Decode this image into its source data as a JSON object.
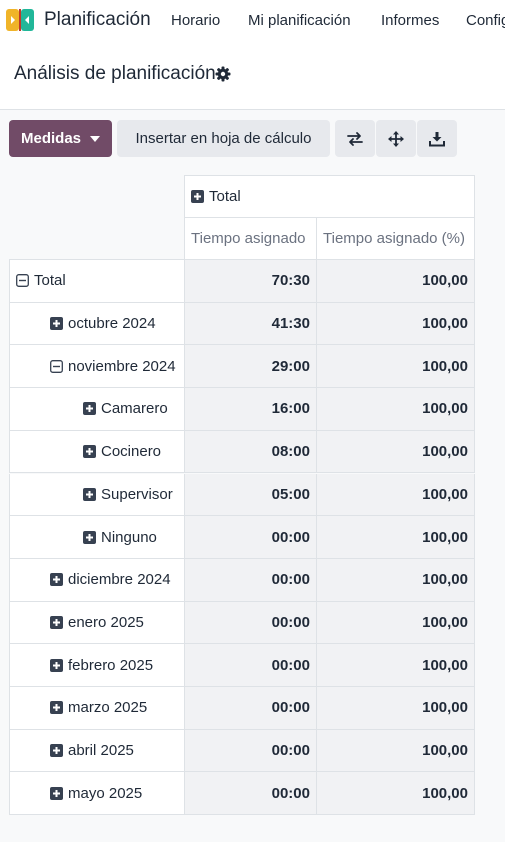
{
  "navbar": {
    "app_title": "Planificación",
    "menu": [
      "Horario",
      "Mi planificación",
      "Informes",
      "Configuración"
    ]
  },
  "control_panel": {
    "title": "Análisis de planificación"
  },
  "toolbar": {
    "measures_label": "Medidas",
    "insert_label": "Insertar en hoja de cálculo",
    "icons": [
      "flip-axis-icon",
      "expand-all-icon",
      "download-icon"
    ]
  },
  "pivot": {
    "col_header": "Total",
    "measures": [
      "Tiempo asignado",
      "Tiempo asignado (%)"
    ],
    "rows": [
      {
        "label": "Total",
        "level": 0,
        "state": "expanded",
        "hours": "70:30",
        "pct": "100,00"
      },
      {
        "label": "octubre 2024",
        "level": 1,
        "state": "collapsed",
        "hours": "41:30",
        "pct": "100,00"
      },
      {
        "label": "noviembre 2024",
        "level": 1,
        "state": "expanded",
        "hours": "29:00",
        "pct": "100,00"
      },
      {
        "label": "Camarero",
        "level": 2,
        "state": "collapsed",
        "hours": "16:00",
        "pct": "100,00"
      },
      {
        "label": "Cocinero",
        "level": 2,
        "state": "collapsed",
        "hours": "08:00",
        "pct": "100,00"
      },
      {
        "label": "Supervisor",
        "level": 2,
        "state": "collapsed",
        "hours": "05:00",
        "pct": "100,00"
      },
      {
        "label": "Ninguno",
        "level": 2,
        "state": "collapsed",
        "hours": "00:00",
        "pct": "100,00"
      },
      {
        "label": "diciembre 2024",
        "level": 1,
        "state": "collapsed",
        "hours": "00:00",
        "pct": "100,00"
      },
      {
        "label": "enero 2025",
        "level": 1,
        "state": "collapsed",
        "hours": "00:00",
        "pct": "100,00"
      },
      {
        "label": "febrero 2025",
        "level": 1,
        "state": "collapsed",
        "hours": "00:00",
        "pct": "100,00"
      },
      {
        "label": "marzo 2025",
        "level": 1,
        "state": "collapsed",
        "hours": "00:00",
        "pct": "100,00"
      },
      {
        "label": "abril 2025",
        "level": 1,
        "state": "collapsed",
        "hours": "00:00",
        "pct": "100,00"
      },
      {
        "label": "mayo 2025",
        "level": 1,
        "state": "collapsed",
        "hours": "00:00",
        "pct": "100,00"
      }
    ]
  },
  "colors": {
    "brand": "#714b67",
    "button_secondary": "#e7e9ed",
    "value_cell": "#f1f2f4"
  }
}
